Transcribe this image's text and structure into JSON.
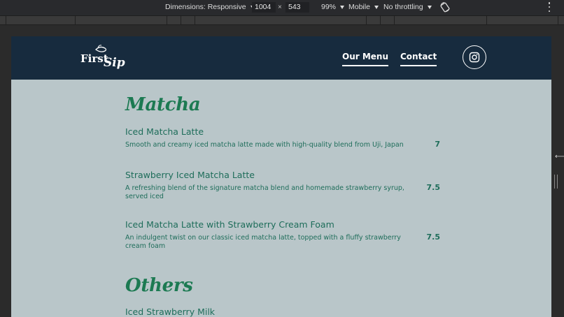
{
  "devtools": {
    "dimensions_label": "Dimensions: Responsive",
    "width_value": "1004",
    "times": "×",
    "height_value": "543",
    "zoom_label": "99%",
    "device_type_label": "Mobile",
    "throttle_label": "No throttling"
  },
  "site": {
    "brand": {
      "logo_text": "FirstSip"
    },
    "nav": [
      {
        "label": "Our Menu"
      },
      {
        "label": "Contact"
      }
    ],
    "sections": [
      {
        "title": "Matcha",
        "items": [
          {
            "name": "Iced Matcha Latte",
            "description": "Smooth and creamy iced matcha latte made with high-quality blend from Uji, Japan",
            "price": "7"
          },
          {
            "name": "Strawberry Iced Matcha Latte",
            "description": "A refreshing blend of the signature matcha blend and homemade strawberry syrup, served iced",
            "price": "7.5"
          },
          {
            "name": "Iced Matcha Latte with Strawberry Cream Foam",
            "description": "An indulgent twist on our classic iced matcha latte, topped with a fluffy strawberry cream foam",
            "price": "7.5"
          }
        ]
      },
      {
        "title": "Others",
        "items": [
          {
            "name": "Iced Strawberry Milk"
          }
        ]
      }
    ],
    "colors": {
      "header_bg": "#172b3e",
      "page_bg": "#b9c6c9",
      "section_title": "#1c7a52",
      "item_text": "#1e6d5a"
    }
  }
}
